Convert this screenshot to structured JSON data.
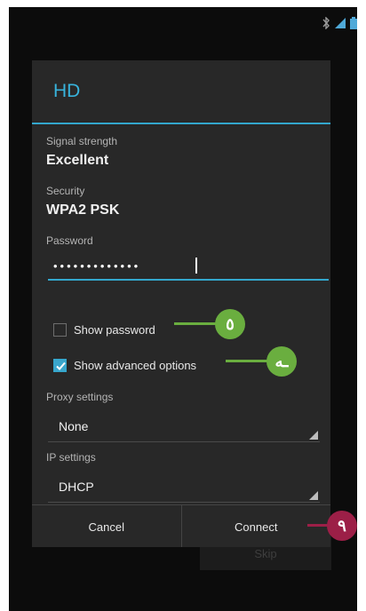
{
  "colors": {
    "accent": "#33a7cd",
    "callout_green": "#6aae3f",
    "callout_red": "#9c1f47"
  },
  "status_bar": {
    "icons": [
      "bluetooth-icon",
      "signal-icon",
      "battery-icon"
    ]
  },
  "dialog": {
    "title": "HD",
    "signal_label": "Signal strength",
    "signal_value": "Excellent",
    "security_label": "Security",
    "security_value": "WPA2 PSK",
    "password_label": "Password",
    "password_value": "•••••••••••••",
    "show_password": {
      "label": "Show password",
      "checked": false
    },
    "advanced_options": {
      "label": "Show advanced options",
      "checked": true
    },
    "proxy_label": "Proxy settings",
    "proxy_value": "None",
    "ip_label": "IP settings",
    "ip_value": "DHCP",
    "cancel_label": "Cancel",
    "connect_label": "Connect"
  },
  "background": {
    "skip_label": "Skip"
  },
  "callouts": [
    {
      "label": "٥",
      "color": "green",
      "target": "Show password"
    },
    {
      "label": "ـه",
      "color": "green",
      "target": "Show advanced options"
    },
    {
      "label": "٩",
      "color": "red",
      "target": "Connect"
    }
  ]
}
